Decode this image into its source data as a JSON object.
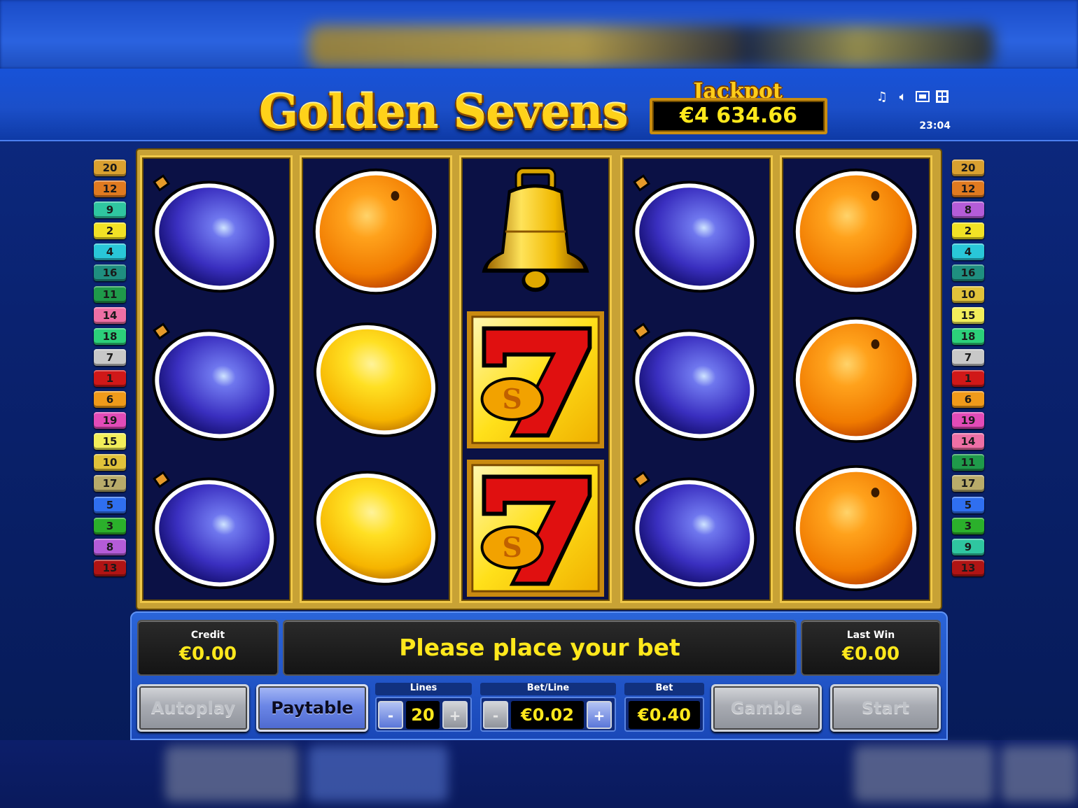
{
  "game": {
    "title": "Golden Sevens",
    "jackpot_label": "Jackpot",
    "jackpot_value": "€4 634.66",
    "clock": "23:04",
    "icons": [
      "music-icon",
      "sound-icon",
      "fullscreen-icon",
      "settings-icon"
    ]
  },
  "left_lines": [
    {
      "n": "20",
      "color": "#d9a030"
    },
    {
      "n": "12",
      "color": "#e07a20"
    },
    {
      "n": "9",
      "color": "#2fc6a0"
    },
    {
      "n": "2",
      "color": "#f2e225"
    },
    {
      "n": "4",
      "color": "#29c7d8"
    },
    {
      "n": "16",
      "color": "#1f8f80"
    },
    {
      "n": "11",
      "color": "#1f9a4a"
    },
    {
      "n": "14",
      "color": "#ee6fa5"
    },
    {
      "n": "18",
      "color": "#2cd07a"
    },
    {
      "n": "7",
      "color": "#c8c8c8"
    },
    {
      "n": "1",
      "color": "#d01818"
    },
    {
      "n": "6",
      "color": "#f09a1a"
    },
    {
      "n": "19",
      "color": "#e24bb8"
    },
    {
      "n": "15",
      "color": "#f2ee5a"
    },
    {
      "n": "10",
      "color": "#e0c23a"
    },
    {
      "n": "17",
      "color": "#b8ab6a"
    },
    {
      "n": "5",
      "color": "#2f6ff0"
    },
    {
      "n": "3",
      "color": "#2bb02b"
    },
    {
      "n": "8",
      "color": "#b45cd8"
    },
    {
      "n": "13",
      "color": "#b01414"
    }
  ],
  "right_lines": [
    {
      "n": "20",
      "color": "#d9a030"
    },
    {
      "n": "12",
      "color": "#e07a20"
    },
    {
      "n": "8",
      "color": "#b45cd8"
    },
    {
      "n": "2",
      "color": "#f2e225"
    },
    {
      "n": "4",
      "color": "#29c7d8"
    },
    {
      "n": "16",
      "color": "#1f8f80"
    },
    {
      "n": "10",
      "color": "#e0c23a"
    },
    {
      "n": "15",
      "color": "#f2ee5a"
    },
    {
      "n": "18",
      "color": "#2cd07a"
    },
    {
      "n": "7",
      "color": "#c8c8c8"
    },
    {
      "n": "1",
      "color": "#d01818"
    },
    {
      "n": "6",
      "color": "#f09a1a"
    },
    {
      "n": "19",
      "color": "#e24bb8"
    },
    {
      "n": "14",
      "color": "#ee6fa5"
    },
    {
      "n": "11",
      "color": "#1f9a4a"
    },
    {
      "n": "17",
      "color": "#b8ab6a"
    },
    {
      "n": "5",
      "color": "#2f6ff0"
    },
    {
      "n": "3",
      "color": "#2bb02b"
    },
    {
      "n": "9",
      "color": "#2fc6a0"
    },
    {
      "n": "13",
      "color": "#b01414"
    }
  ],
  "reels": [
    [
      "plum",
      "plum",
      "plum"
    ],
    [
      "orange",
      "lemon",
      "lemon"
    ],
    [
      "bell",
      "seven",
      "seven"
    ],
    [
      "plum",
      "plum",
      "plum"
    ],
    [
      "orange",
      "orange",
      "orange"
    ]
  ],
  "panel": {
    "credit_label": "Credit",
    "credit_value": "€0.00",
    "message": "Please place your bet",
    "last_win_label": "Last Win",
    "last_win_value": "€0.00",
    "autoplay_label": "Autoplay",
    "paytable_label": "Paytable",
    "gamble_label": "Gamble",
    "start_label": "Start",
    "lines_label": "Lines",
    "lines_value": "20",
    "bet_line_label": "Bet/Line",
    "bet_line_value": "€0.02",
    "bet_label": "Bet",
    "bet_value": "€0.40",
    "minus_symbol": "-",
    "plus_symbol": "+"
  }
}
